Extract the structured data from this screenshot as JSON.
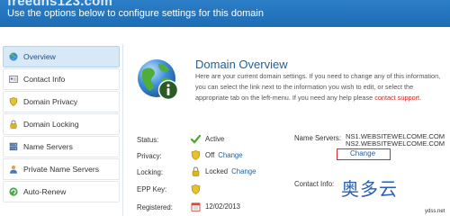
{
  "header": {
    "brand": "freedns123.com",
    "subtitle": "Use the options below to configure settings for this domain"
  },
  "sidebar": {
    "items": [
      {
        "label": "Overview",
        "icon": "globe-icon"
      },
      {
        "label": "Contact Info",
        "icon": "contact-card-icon"
      },
      {
        "label": "Domain Privacy",
        "icon": "shield-icon"
      },
      {
        "label": "Domain Locking",
        "icon": "lock-icon"
      },
      {
        "label": "Name Servers",
        "icon": "server-icon"
      },
      {
        "label": "Private Name Servers",
        "icon": "user-icon"
      },
      {
        "label": "Auto-Renew",
        "icon": "renew-icon"
      }
    ]
  },
  "overview": {
    "title": "Domain Overview",
    "description_prefix": "Here are your current domain settings. If you need to change any of this information, you can select the link next to the information you wish to edit, or select the appropriate tab on the left-menu. If you need any help please ",
    "support_link": "contact support",
    "description_suffix": "."
  },
  "status_rows": {
    "status": {
      "label": "Status:",
      "value": "Active"
    },
    "privacy": {
      "label": "Privacy:",
      "value": "Off",
      "link": "Change"
    },
    "locking": {
      "label": "Locking:",
      "value": "Locked",
      "link": "Change"
    },
    "epp": {
      "label": "EPP Key:",
      "value": ""
    },
    "registered": {
      "label": "Registered:",
      "value": "12/02/2013"
    }
  },
  "name_servers": {
    "label": "Name Servers:",
    "ns1": "NS1.WEBSITEWELCOME.COM",
    "ns2": "NS2.WEBSITEWELCOME.COM",
    "change": "Change"
  },
  "contact_info": {
    "label": "Contact Info:"
  },
  "watermark": {
    "text": "奥多云",
    "sub": "ydss.net"
  },
  "colors": {
    "header": "#1d6db5",
    "link": "#1f5f9c",
    "accent_red": "#d0241c"
  }
}
